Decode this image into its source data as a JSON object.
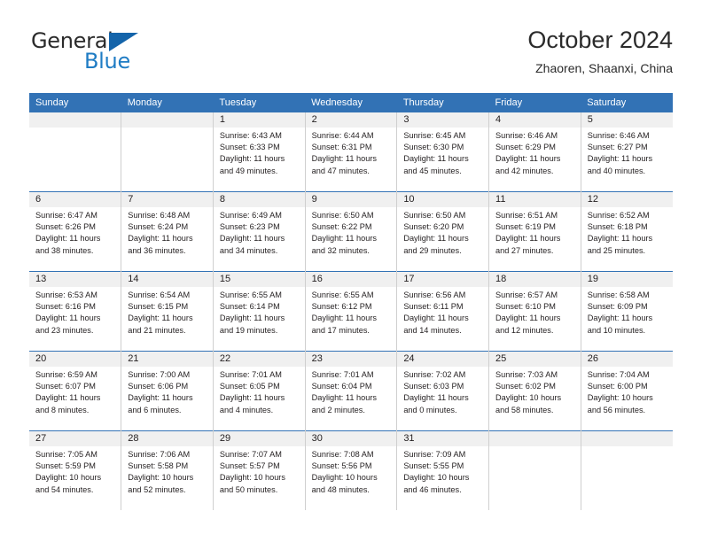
{
  "brand": {
    "name_part1": "General",
    "name_part2": "Blue",
    "accent_color": "#1f7cc4",
    "triangle_color": "#1464aa"
  },
  "header": {
    "title": "October 2024",
    "subtitle": "Zhaoren, Shaanxi, China"
  },
  "theme": {
    "header_row_bg": "#3272b5",
    "daynum_bg": "#f0f0f0",
    "grid_line": "#cfcfcf",
    "text": "#231f20"
  },
  "weekdays": [
    "Sunday",
    "Monday",
    "Tuesday",
    "Wednesday",
    "Thursday",
    "Friday",
    "Saturday"
  ],
  "weeks": [
    [
      {
        "day": "",
        "blank": true
      },
      {
        "day": "",
        "blank": true
      },
      {
        "day": "1",
        "sunrise": "Sunrise: 6:43 AM",
        "sunset": "Sunset: 6:33 PM",
        "daylight1": "Daylight: 11 hours",
        "daylight2": "and 49 minutes."
      },
      {
        "day": "2",
        "sunrise": "Sunrise: 6:44 AM",
        "sunset": "Sunset: 6:31 PM",
        "daylight1": "Daylight: 11 hours",
        "daylight2": "and 47 minutes."
      },
      {
        "day": "3",
        "sunrise": "Sunrise: 6:45 AM",
        "sunset": "Sunset: 6:30 PM",
        "daylight1": "Daylight: 11 hours",
        "daylight2": "and 45 minutes."
      },
      {
        "day": "4",
        "sunrise": "Sunrise: 6:46 AM",
        "sunset": "Sunset: 6:29 PM",
        "daylight1": "Daylight: 11 hours",
        "daylight2": "and 42 minutes."
      },
      {
        "day": "5",
        "sunrise": "Sunrise: 6:46 AM",
        "sunset": "Sunset: 6:27 PM",
        "daylight1": "Daylight: 11 hours",
        "daylight2": "and 40 minutes."
      }
    ],
    [
      {
        "day": "6",
        "sunrise": "Sunrise: 6:47 AM",
        "sunset": "Sunset: 6:26 PM",
        "daylight1": "Daylight: 11 hours",
        "daylight2": "and 38 minutes."
      },
      {
        "day": "7",
        "sunrise": "Sunrise: 6:48 AM",
        "sunset": "Sunset: 6:24 PM",
        "daylight1": "Daylight: 11 hours",
        "daylight2": "and 36 minutes."
      },
      {
        "day": "8",
        "sunrise": "Sunrise: 6:49 AM",
        "sunset": "Sunset: 6:23 PM",
        "daylight1": "Daylight: 11 hours",
        "daylight2": "and 34 minutes."
      },
      {
        "day": "9",
        "sunrise": "Sunrise: 6:50 AM",
        "sunset": "Sunset: 6:22 PM",
        "daylight1": "Daylight: 11 hours",
        "daylight2": "and 32 minutes."
      },
      {
        "day": "10",
        "sunrise": "Sunrise: 6:50 AM",
        "sunset": "Sunset: 6:20 PM",
        "daylight1": "Daylight: 11 hours",
        "daylight2": "and 29 minutes."
      },
      {
        "day": "11",
        "sunrise": "Sunrise: 6:51 AM",
        "sunset": "Sunset: 6:19 PM",
        "daylight1": "Daylight: 11 hours",
        "daylight2": "and 27 minutes."
      },
      {
        "day": "12",
        "sunrise": "Sunrise: 6:52 AM",
        "sunset": "Sunset: 6:18 PM",
        "daylight1": "Daylight: 11 hours",
        "daylight2": "and 25 minutes."
      }
    ],
    [
      {
        "day": "13",
        "sunrise": "Sunrise: 6:53 AM",
        "sunset": "Sunset: 6:16 PM",
        "daylight1": "Daylight: 11 hours",
        "daylight2": "and 23 minutes."
      },
      {
        "day": "14",
        "sunrise": "Sunrise: 6:54 AM",
        "sunset": "Sunset: 6:15 PM",
        "daylight1": "Daylight: 11 hours",
        "daylight2": "and 21 minutes."
      },
      {
        "day": "15",
        "sunrise": "Sunrise: 6:55 AM",
        "sunset": "Sunset: 6:14 PM",
        "daylight1": "Daylight: 11 hours",
        "daylight2": "and 19 minutes."
      },
      {
        "day": "16",
        "sunrise": "Sunrise: 6:55 AM",
        "sunset": "Sunset: 6:12 PM",
        "daylight1": "Daylight: 11 hours",
        "daylight2": "and 17 minutes."
      },
      {
        "day": "17",
        "sunrise": "Sunrise: 6:56 AM",
        "sunset": "Sunset: 6:11 PM",
        "daylight1": "Daylight: 11 hours",
        "daylight2": "and 14 minutes."
      },
      {
        "day": "18",
        "sunrise": "Sunrise: 6:57 AM",
        "sunset": "Sunset: 6:10 PM",
        "daylight1": "Daylight: 11 hours",
        "daylight2": "and 12 minutes."
      },
      {
        "day": "19",
        "sunrise": "Sunrise: 6:58 AM",
        "sunset": "Sunset: 6:09 PM",
        "daylight1": "Daylight: 11 hours",
        "daylight2": "and 10 minutes."
      }
    ],
    [
      {
        "day": "20",
        "sunrise": "Sunrise: 6:59 AM",
        "sunset": "Sunset: 6:07 PM",
        "daylight1": "Daylight: 11 hours",
        "daylight2": "and 8 minutes."
      },
      {
        "day": "21",
        "sunrise": "Sunrise: 7:00 AM",
        "sunset": "Sunset: 6:06 PM",
        "daylight1": "Daylight: 11 hours",
        "daylight2": "and 6 minutes."
      },
      {
        "day": "22",
        "sunrise": "Sunrise: 7:01 AM",
        "sunset": "Sunset: 6:05 PM",
        "daylight1": "Daylight: 11 hours",
        "daylight2": "and 4 minutes."
      },
      {
        "day": "23",
        "sunrise": "Sunrise: 7:01 AM",
        "sunset": "Sunset: 6:04 PM",
        "daylight1": "Daylight: 11 hours",
        "daylight2": "and 2 minutes."
      },
      {
        "day": "24",
        "sunrise": "Sunrise: 7:02 AM",
        "sunset": "Sunset: 6:03 PM",
        "daylight1": "Daylight: 11 hours",
        "daylight2": "and 0 minutes."
      },
      {
        "day": "25",
        "sunrise": "Sunrise: 7:03 AM",
        "sunset": "Sunset: 6:02 PM",
        "daylight1": "Daylight: 10 hours",
        "daylight2": "and 58 minutes."
      },
      {
        "day": "26",
        "sunrise": "Sunrise: 7:04 AM",
        "sunset": "Sunset: 6:00 PM",
        "daylight1": "Daylight: 10 hours",
        "daylight2": "and 56 minutes."
      }
    ],
    [
      {
        "day": "27",
        "sunrise": "Sunrise: 7:05 AM",
        "sunset": "Sunset: 5:59 PM",
        "daylight1": "Daylight: 10 hours",
        "daylight2": "and 54 minutes."
      },
      {
        "day": "28",
        "sunrise": "Sunrise: 7:06 AM",
        "sunset": "Sunset: 5:58 PM",
        "daylight1": "Daylight: 10 hours",
        "daylight2": "and 52 minutes."
      },
      {
        "day": "29",
        "sunrise": "Sunrise: 7:07 AM",
        "sunset": "Sunset: 5:57 PM",
        "daylight1": "Daylight: 10 hours",
        "daylight2": "and 50 minutes."
      },
      {
        "day": "30",
        "sunrise": "Sunrise: 7:08 AM",
        "sunset": "Sunset: 5:56 PM",
        "daylight1": "Daylight: 10 hours",
        "daylight2": "and 48 minutes."
      },
      {
        "day": "31",
        "sunrise": "Sunrise: 7:09 AM",
        "sunset": "Sunset: 5:55 PM",
        "daylight1": "Daylight: 10 hours",
        "daylight2": "and 46 minutes."
      },
      {
        "day": "",
        "blank": true
      },
      {
        "day": "",
        "blank": true
      }
    ]
  ]
}
